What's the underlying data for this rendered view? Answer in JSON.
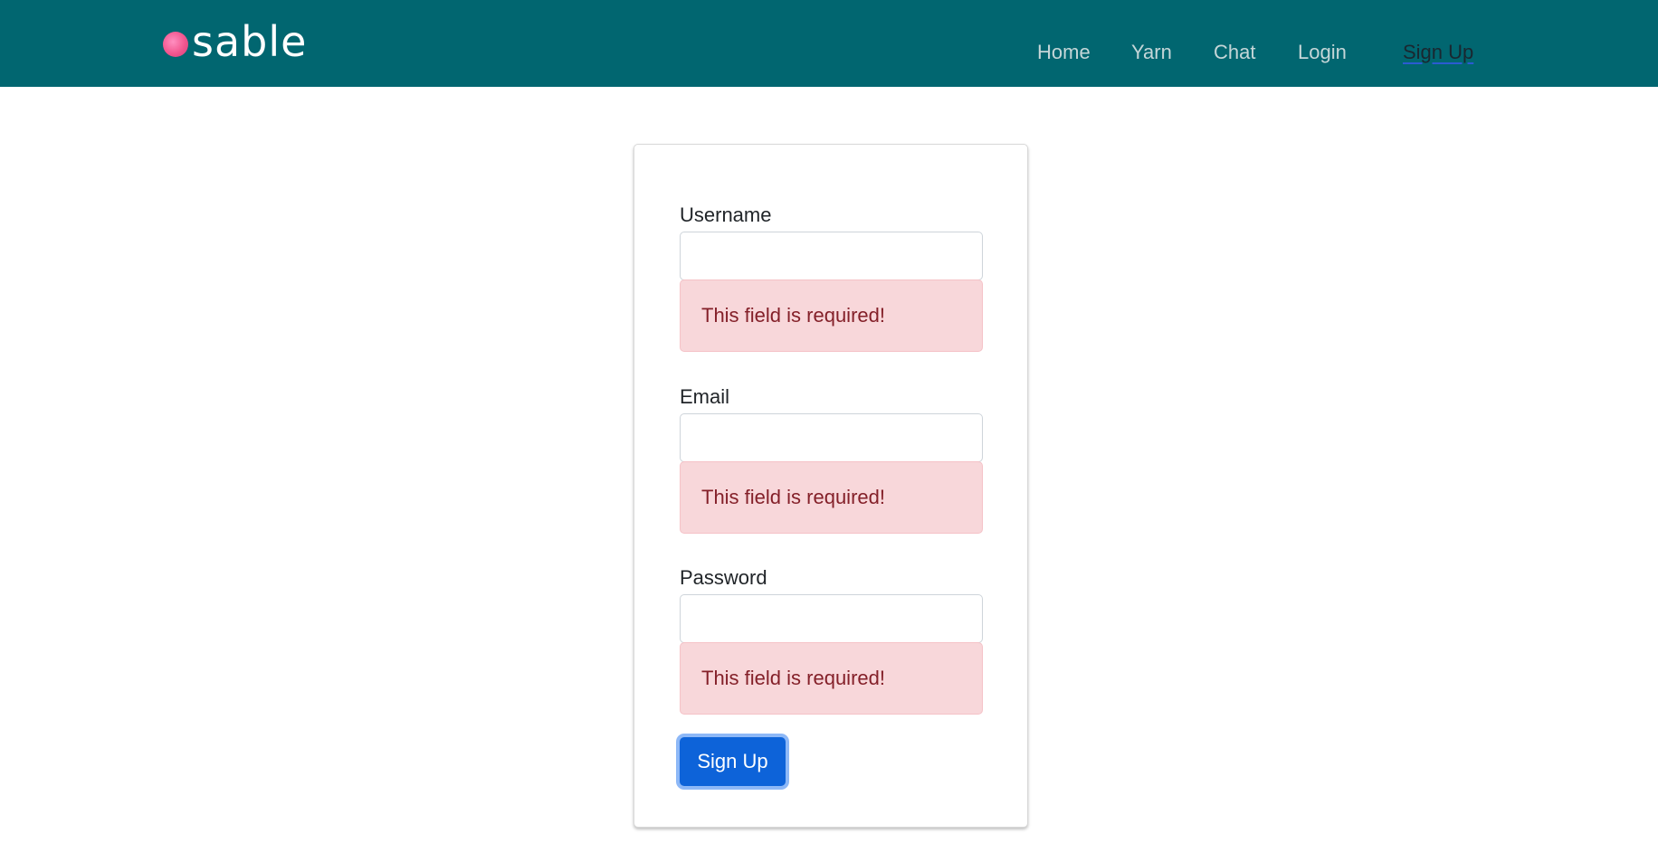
{
  "navbar": {
    "brand": "sable",
    "links": [
      {
        "label": "Home"
      },
      {
        "label": "Yarn"
      },
      {
        "label": "Chat"
      },
      {
        "label": "Login"
      },
      {
        "label": "Sign Up",
        "active": true
      }
    ]
  },
  "form": {
    "fields": [
      {
        "label": "Username",
        "value": "",
        "placeholder": "",
        "error": "This field is required!"
      },
      {
        "label": "Email",
        "value": "",
        "placeholder": "",
        "error": "This field is required!"
      },
      {
        "label": "Password",
        "value": "",
        "placeholder": "",
        "error": "This field is required!"
      }
    ],
    "submit_label": "Sign Up"
  },
  "colors": {
    "navbar_bg": "#016670",
    "primary_button": "#0d63d9",
    "error_bg": "#f8d7da",
    "error_text": "#842029",
    "brand_ball": "#f2568f"
  }
}
